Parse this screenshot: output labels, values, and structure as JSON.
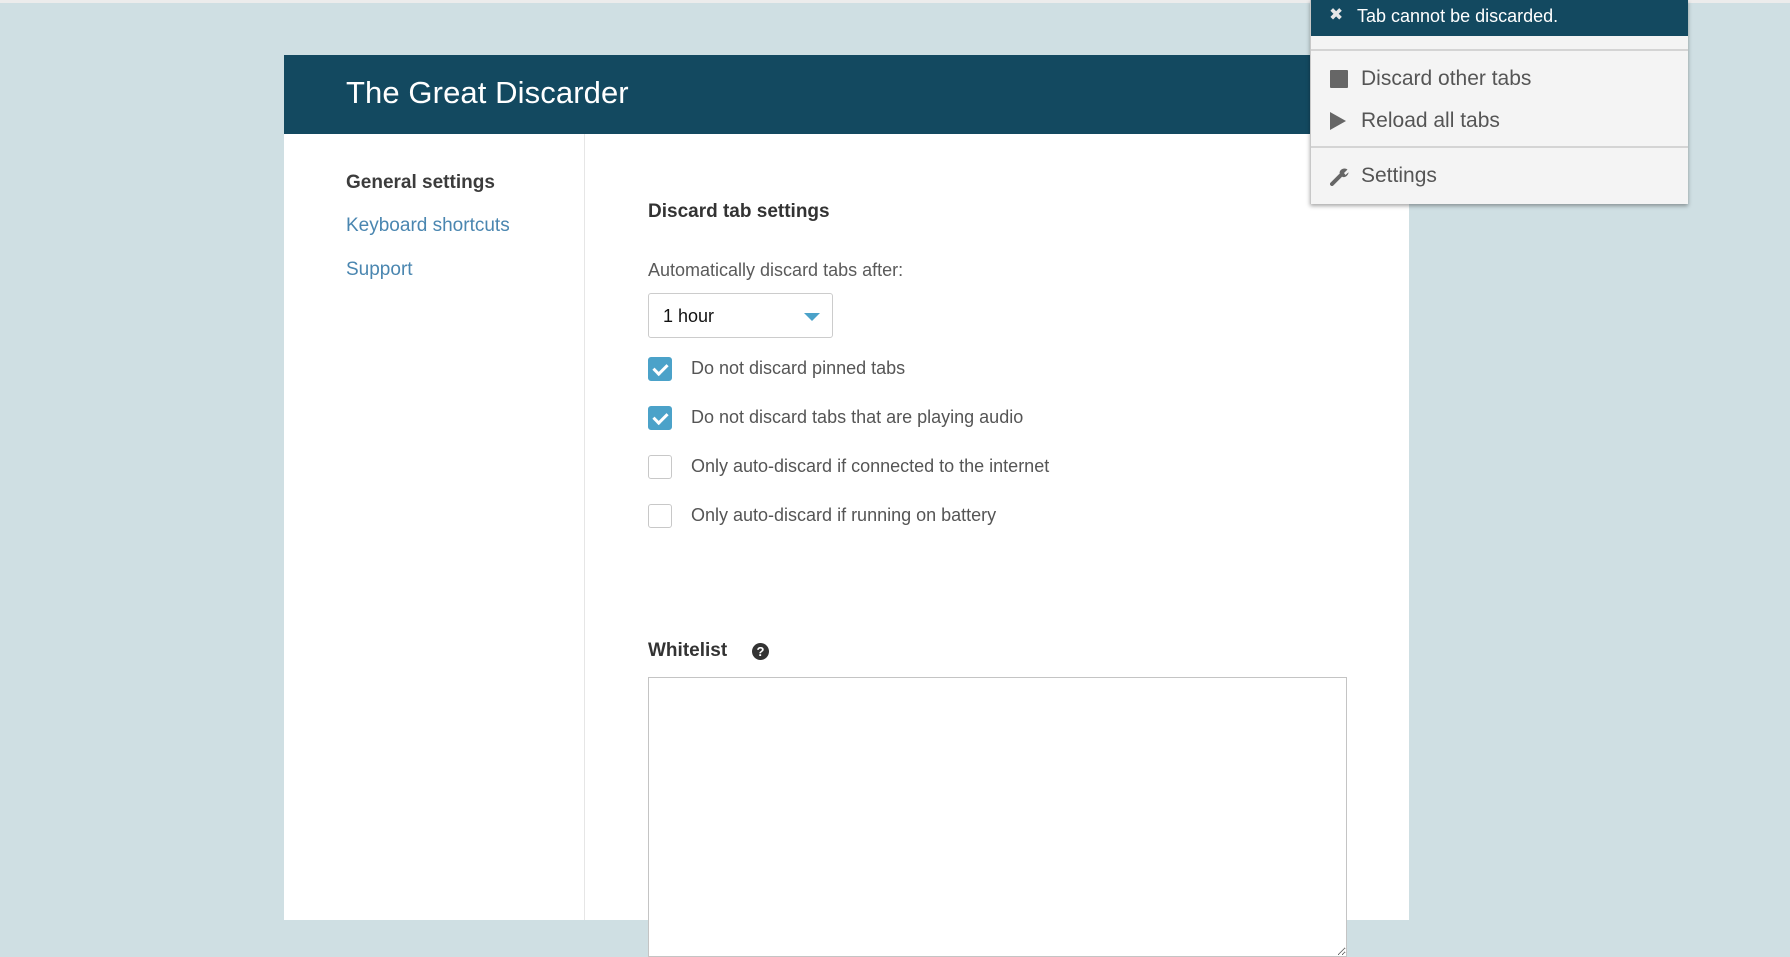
{
  "app": {
    "title": "The Great Discarder"
  },
  "sidebar": {
    "items": [
      {
        "label": "General settings",
        "active": true
      },
      {
        "label": "Keyboard shortcuts",
        "active": false
      },
      {
        "label": "Support",
        "active": false
      }
    ]
  },
  "main": {
    "section_title": "Discard tab settings",
    "auto_discard": {
      "label": "Automatically discard tabs after:",
      "selected": "1 hour"
    },
    "options": [
      {
        "label": "Do not discard pinned tabs",
        "checked": true
      },
      {
        "label": "Do not discard tabs that are playing audio",
        "checked": true
      },
      {
        "label": "Only auto-discard if connected to the internet",
        "checked": false
      },
      {
        "label": "Only auto-discard if running on battery",
        "checked": false
      }
    ],
    "whitelist": {
      "title": "Whitelist",
      "help_icon": "question-circle-icon",
      "value": "",
      "placeholder": ""
    }
  },
  "popup": {
    "notice": {
      "icon": "close-icon",
      "text": "Tab cannot be discarded."
    },
    "menu": [
      {
        "icon": "stop-square-icon",
        "label": "Discard other tabs"
      },
      {
        "icon": "play-icon",
        "label": "Reload all tabs"
      },
      {
        "icon": "wrench-icon",
        "label": "Settings"
      }
    ]
  },
  "colors": {
    "header": "#134960",
    "background": "#cfdfe3",
    "accent": "#4ba2c9",
    "link": "#4a86b0"
  }
}
